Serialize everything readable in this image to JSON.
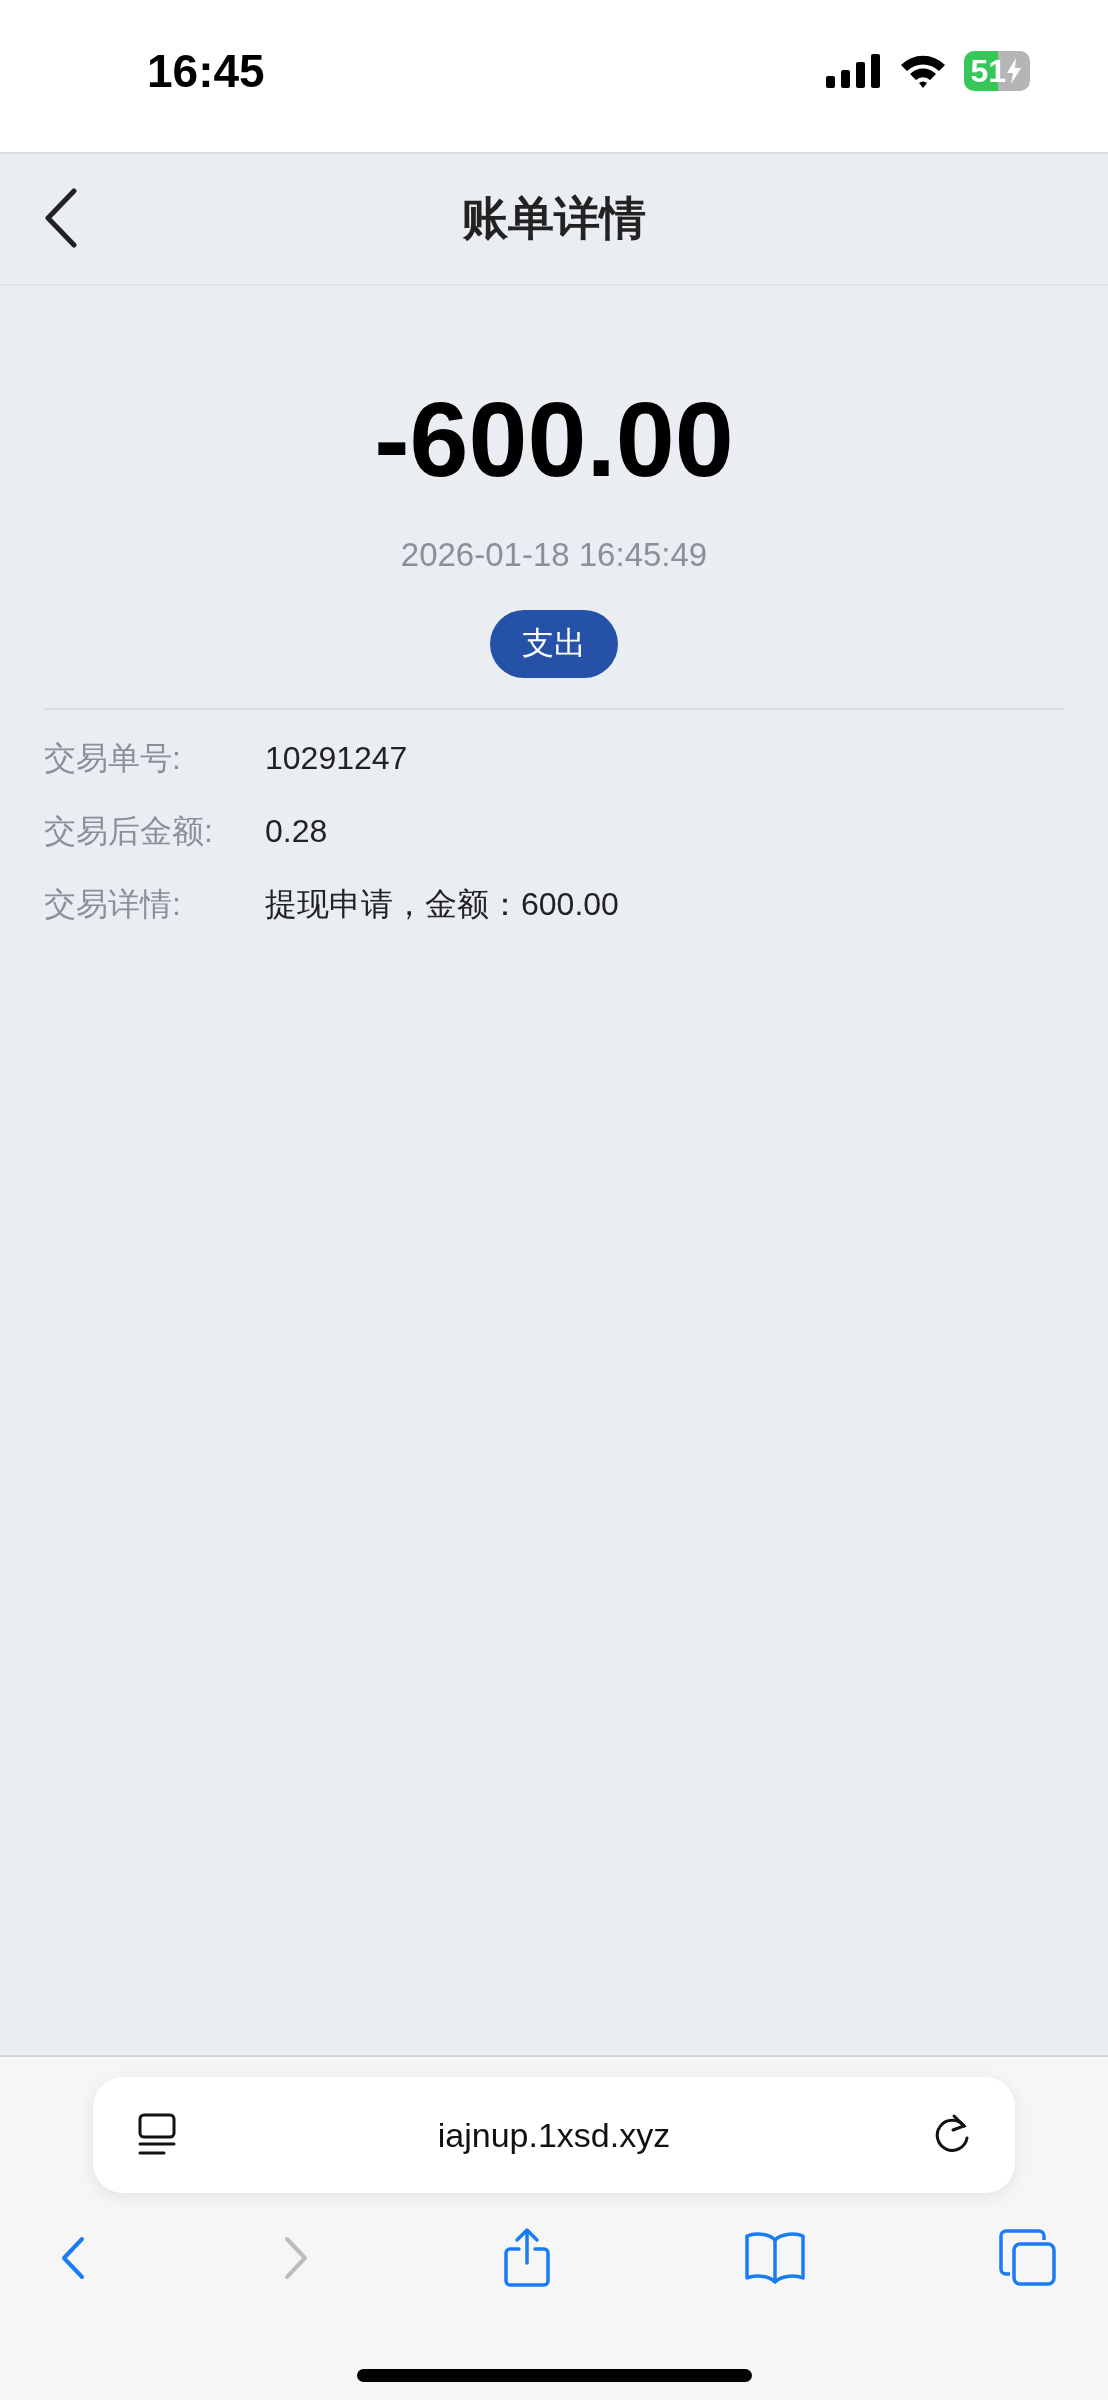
{
  "status_bar": {
    "time": "16:45",
    "battery": "51"
  },
  "header": {
    "title": "账单详情"
  },
  "transaction": {
    "amount": "-600.00",
    "datetime": "2026-01-18 16:45:49",
    "type_badge": "支出"
  },
  "details": [
    {
      "label": "交易单号:",
      "value": "10291247"
    },
    {
      "label": "交易后金额:",
      "value": "0.28"
    },
    {
      "label": "交易详情:",
      "value": "提现申请，金额：600.00"
    }
  ],
  "browser": {
    "url": "iajnup.1xsd.xyz",
    "toolbar": [
      {
        "kind": "back",
        "disabled": false
      },
      {
        "kind": "forward",
        "disabled": true
      },
      {
        "kind": "share",
        "disabled": false
      },
      {
        "kind": "bookmarks",
        "disabled": false
      },
      {
        "kind": "tabs",
        "disabled": false
      }
    ]
  }
}
